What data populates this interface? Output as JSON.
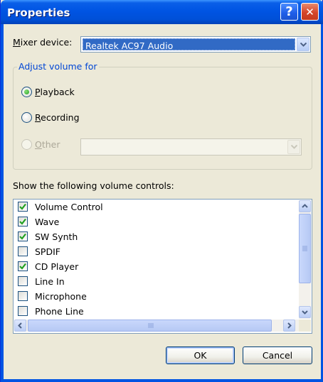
{
  "window": {
    "title": "Properties"
  },
  "title_buttons": {
    "help": "?",
    "close": "✕"
  },
  "mixer": {
    "label_prefix": "M",
    "label_rest": "ixer device:",
    "selected": "Realtek AC97 Audio"
  },
  "adjust_group": {
    "legend": "Adjust volume for",
    "options": [
      {
        "key": "P",
        "rest": "layback",
        "checked": true,
        "enabled": true
      },
      {
        "key": "R",
        "rest": "ecording",
        "checked": false,
        "enabled": true
      },
      {
        "key": "O",
        "rest": "ther",
        "checked": false,
        "enabled": false
      }
    ]
  },
  "controls_label": "Show the following volume controls:",
  "controls": [
    {
      "label": "Volume Control",
      "checked": true
    },
    {
      "label": "Wave",
      "checked": true
    },
    {
      "label": "SW Synth",
      "checked": true
    },
    {
      "label": "SPDIF",
      "checked": false
    },
    {
      "label": "CD Player",
      "checked": true
    },
    {
      "label": "Line In",
      "checked": false
    },
    {
      "label": "Microphone",
      "checked": false
    },
    {
      "label": "Phone Line",
      "checked": false
    }
  ],
  "buttons": {
    "ok": "OK",
    "cancel": "Cancel"
  },
  "colors": {
    "title_bar": "#0054e3",
    "selection": "#316ac5",
    "legend_text": "#0046d5",
    "dialog_bg": "#ece9d8"
  }
}
